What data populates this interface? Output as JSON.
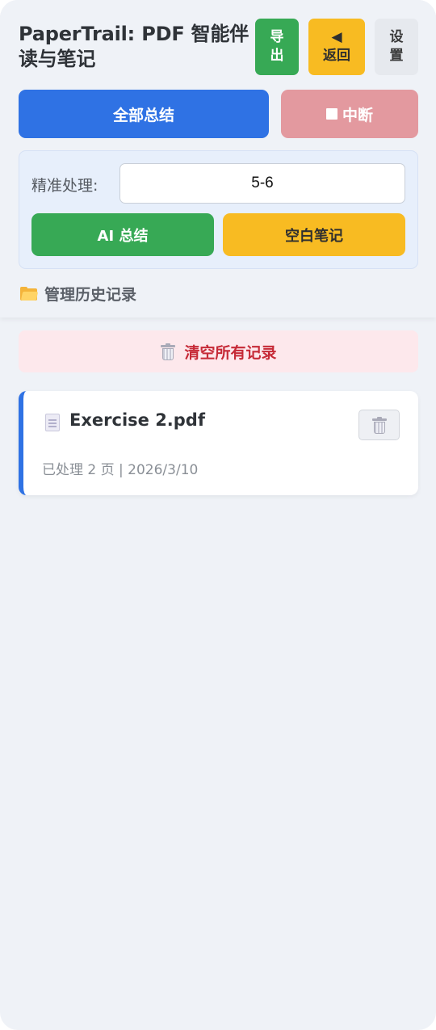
{
  "header": {
    "title": "PaperTrail: PDF 智能伴读与笔记",
    "export_label": [
      "导",
      "出"
    ],
    "back_label": [
      "◀",
      "返回"
    ],
    "settings_label": [
      "设",
      "置"
    ]
  },
  "actions": {
    "summarize_all_label": "全部总结",
    "stop_label": "中断"
  },
  "precise": {
    "label": "精准处理:",
    "input_value": "5-6",
    "ai_summary_label": "AI 总结",
    "blank_note_label": "空白笔记"
  },
  "history": {
    "manage_label": "管理历史记录",
    "clear_all_label": "清空所有记录",
    "files": [
      {
        "name": "Exercise 2.pdf",
        "meta": "已处理 2 页 | 2026/3/10"
      }
    ]
  },
  "colors": {
    "primary_blue": "#2f72e4",
    "green": "#37a955",
    "yellow": "#f8bb22",
    "stop_pink": "#e3999f",
    "danger_red": "#c62a37"
  },
  "icons": {
    "stop": "stop-square-icon",
    "history": "folder-icon",
    "clear": "trash-icon",
    "file": "document-icon",
    "file_delete": "trash-icon"
  }
}
